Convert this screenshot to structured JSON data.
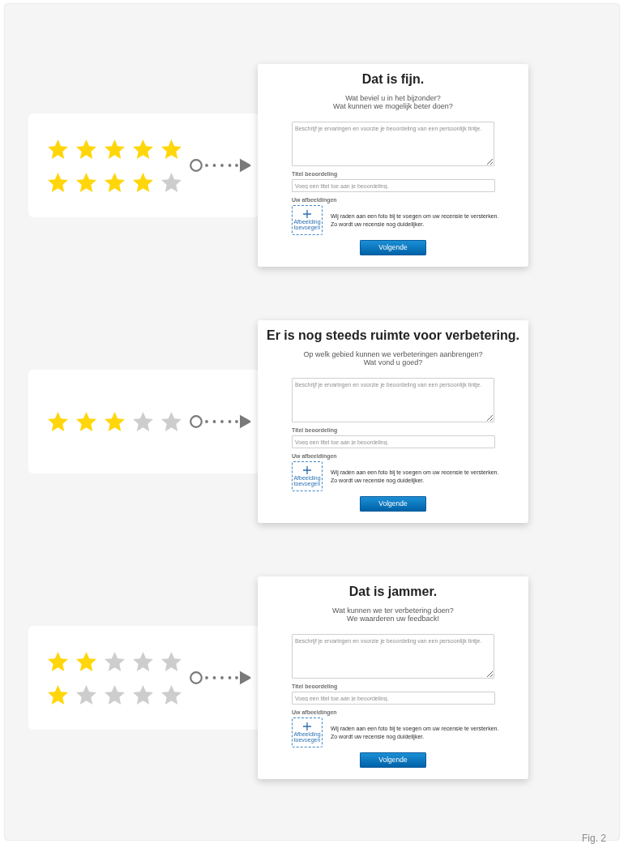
{
  "scenarios": [
    {
      "rating_rows": [
        {
          "stars": 5
        },
        {
          "stars": 4
        }
      ],
      "form": {
        "title": "Dat is fijn.",
        "subtitle_lines": [
          "Wat beviel u in het bijzonder?",
          "Wat kunnen we mogelijk beter doen?"
        ],
        "review_field": {
          "placeholder": "Beschrijf je ervaringen en voorzie je beoordeling van een persoonlijk tintje."
        },
        "title_field": {
          "label": "Titel beoordeling",
          "placeholder": "Voeg een titel toe aan je beoordeling."
        },
        "images_label": "Uw afbeeldingen",
        "add_image_button": "Afbeelding toevoegen",
        "hint_lines": [
          "Wij raden aan een foto bij te voegen om uw recensie te versterken.",
          "Zo wordt uw recensie nog duidelijker."
        ],
        "next_button": "Volgende"
      }
    },
    {
      "rating_rows": [
        {
          "stars": 3
        }
      ],
      "form": {
        "title": "Er is nog steeds ruimte voor verbetering.",
        "subtitle_lines": [
          "Op welk gebied kunnen we verbeteringen aanbrengen?",
          "Wat vond u goed?"
        ],
        "review_field": {
          "placeholder": "Beschrijf je ervaringen en voorzie je beoordeling van een persoonlijk tintje."
        },
        "title_field": {
          "label": "Titel beoordeling",
          "placeholder": "Voeg een titel toe aan je beoordeling."
        },
        "images_label": "Uw afbeeldingen",
        "add_image_button": "Afbeelding toevoegen",
        "hint_lines": [
          "Wij raden aan een foto bij te voegen om uw recensie te versterken.",
          "Zo wordt uw recensie nog duidelijker."
        ],
        "next_button": "Volgende"
      }
    },
    {
      "rating_rows": [
        {
          "stars": 2
        },
        {
          "stars": 1
        }
      ],
      "form": {
        "title": "Dat is jammer.",
        "subtitle_lines": [
          "Wat kunnen we ter verbetering doen?",
          "We waarderen uw feedback!"
        ],
        "review_field": {
          "placeholder": "Beschrijf je ervaringen en voorzie je beoordeling van een persoonlijk tintje."
        },
        "title_field": {
          "label": "Titel beoordeling",
          "placeholder": "Voeg een titel toe aan je beoordeling."
        },
        "images_label": "Uw afbeeldingen",
        "add_image_button": "Afbeelding toevoegen",
        "hint_lines": [
          "Wij raden aan een foto bij te voegen om uw recensie te versterken.",
          "Zo wordt uw recensie nog duidelijker."
        ],
        "next_button": "Volgende"
      }
    }
  ],
  "figure_label": "Fig. 2"
}
